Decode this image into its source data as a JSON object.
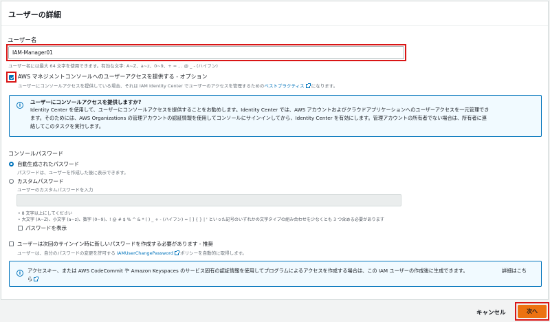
{
  "panel": {
    "title": "ユーザーの詳細"
  },
  "username": {
    "label": "ユーザー名",
    "value": "IAM-Manager01",
    "hint": "ユーザー名には最大 64 文字を使用できます。有効な文字: A~Z、a~z、0~9、+ = , . @ _ - (ハイフン)"
  },
  "console_access": {
    "checked": true,
    "label": "AWS マネジメントコンソールへのユーザーアクセスを提供する - オプション",
    "desc_prefix": "ユーザーにコンソールアクセスを提供している場合、それは IAM Identity Center でユーザーのアクセスを管理するための",
    "desc_link": "ベストプラクティス",
    "desc_suffix": "になります。"
  },
  "identity_info": {
    "title": "ユーザーにコンソールアクセスを提供しますか?",
    "line1": "Identity Center を使用して、ユーザーにコンソールアクセスを提供することをお勧めします。Identity Center では、AWS アカウントおよびクラウドアプリケーションへのユーザーアクセスを一元管理でき",
    "line2": "ます。そのためには、AWS Organizations の管理アカウントの認証情報を使用してコンソールにサインインしてから、Identity Center を有効にします。管理アカウントの所有者でない場合は、所有者に連",
    "line3": "絡してこのタスクを実行します。",
    "icon": "info-icon",
    "border_color": "#0073bb"
  },
  "console_password": {
    "label": "コンソールパスワード",
    "auto": {
      "selected": true,
      "label": "自動生成されたパスワード",
      "desc": "パスワードは、ユーザーを作成した後に表示できます。"
    },
    "custom": {
      "selected": false,
      "label": "カスタムパスワード",
      "desc": "ユーザーのカスタムパスワードを入力",
      "value": ""
    },
    "rules": [
      "8 文字以上にしてください",
      "大文字 (A~Z)、小文字 (a~z)、数字 (0~9)、! @ # $ % ^ & * ( ) _ + - (ハイフン) = [ ] { } | ' といった記号のいずれかの文字タイプの組み合わせを少なくとも 3 つ含める必要があります"
    ],
    "show_password": {
      "checked": false,
      "label": "パスワードを表示"
    }
  },
  "require_reset": {
    "checked": false,
    "label": "ユーザーは次回のサインイン時に新しいパスワードを作成する必要があります - 推奨",
    "desc_prefix": "ユーザーは、自分のパスワードの変更を許可する",
    "desc_link": "IAMUserChangePassword",
    "desc_suffix": "ポリシーを自動的に取得します。"
  },
  "access_key_info": {
    "text": "アクセスキー、または AWS CodeCommit や Amazon Keyspaces のサービス固有の認証情報を使用してプログラムによるアクセスを作成する場合は、この IAM ユーザーの作成後に生成できます。",
    "link_part1": "詳細はこち",
    "link_part2": "ら",
    "icon": "info-icon"
  },
  "footer": {
    "cancel": "キャンセル",
    "next": "次へ"
  },
  "colors": {
    "accent": "#0073bb",
    "primary_button": "#ec7211",
    "highlight": "#d91515"
  }
}
